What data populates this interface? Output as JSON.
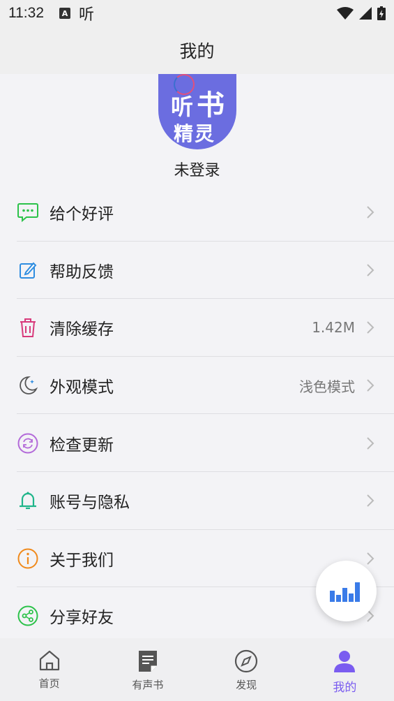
{
  "status_bar": {
    "time": "11:32",
    "notification_a": "A",
    "notification_app": "听"
  },
  "header": {
    "title": "我的"
  },
  "profile": {
    "avatar_text_1": "听",
    "avatar_text_2": "书",
    "avatar_text_3": "精灵",
    "login_status": "未登录"
  },
  "menu": {
    "items": [
      {
        "label": "给个好评",
        "value": "",
        "icon": "chat-bubble-icon",
        "color": "#2cc24a"
      },
      {
        "label": "帮助反馈",
        "value": "",
        "icon": "edit-icon",
        "color": "#2f8de0"
      },
      {
        "label": "清除缓存",
        "value": "1.42M",
        "icon": "trash-icon",
        "color": "#d83a7b"
      },
      {
        "label": "外观模式",
        "value": "浅色模式",
        "icon": "moon-icon",
        "color": "#555555"
      },
      {
        "label": "检查更新",
        "value": "",
        "icon": "refresh-icon",
        "color": "#b36ad9"
      },
      {
        "label": "账号与隐私",
        "value": "",
        "icon": "bell-icon",
        "color": "#1fb58a"
      },
      {
        "label": "关于我们",
        "value": "",
        "icon": "info-icon",
        "color": "#f08a1c"
      },
      {
        "label": "分享好友",
        "value": "",
        "icon": "share-icon",
        "color": "#2cc24a"
      }
    ]
  },
  "bottom_nav": {
    "items": [
      {
        "label": "首页",
        "icon": "home-icon"
      },
      {
        "label": "有声书",
        "icon": "book-icon"
      },
      {
        "label": "发现",
        "icon": "compass-icon"
      },
      {
        "label": "我的",
        "icon": "user-icon"
      }
    ],
    "active_color": "#7a5cf0"
  }
}
